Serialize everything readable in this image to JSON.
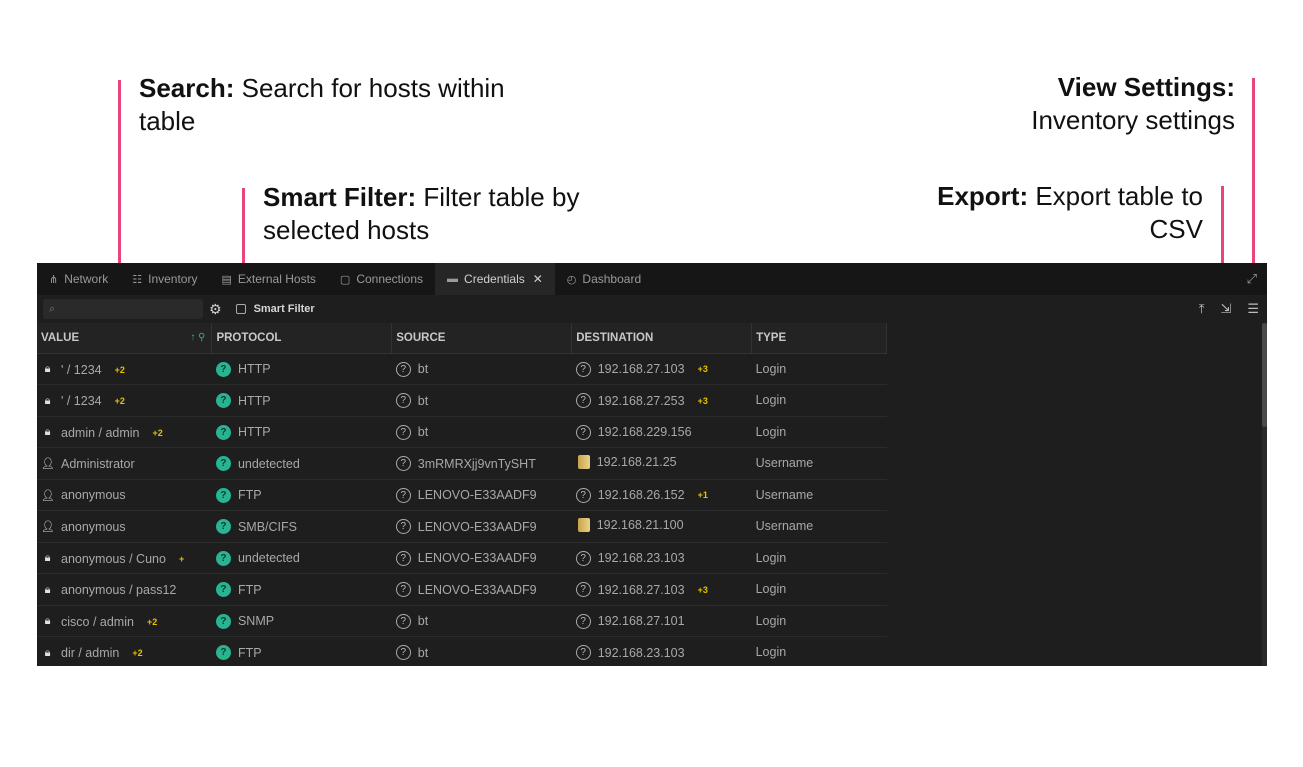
{
  "annotations": {
    "search": {
      "title": "Search:",
      "text": "Search for hosts within table"
    },
    "smart_filter": {
      "title": "Smart Filter:",
      "text": "Filter table by selected hosts"
    },
    "view_settings": {
      "title": "View Settings:",
      "text": "Inventory settings"
    },
    "export": {
      "title": "Export:",
      "text": "Export table to CSV"
    }
  },
  "colors": {
    "accent_line": "#e8457a",
    "protocol_icon": "#27b48f",
    "badge": "#e6c200"
  },
  "tabs": [
    {
      "label": "Network",
      "icon": "network-icon"
    },
    {
      "label": "Inventory",
      "icon": "inventory-icon"
    },
    {
      "label": "External Hosts",
      "icon": "external-hosts-icon"
    },
    {
      "label": "Connections",
      "icon": "connections-icon"
    },
    {
      "label": "Credentials",
      "icon": "credentials-icon",
      "active": true
    },
    {
      "label": "Dashboard",
      "icon": "dashboard-icon"
    }
  ],
  "toolbar": {
    "search_placeholder": "",
    "smart_filter_label": "Smart Filter"
  },
  "table": {
    "columns": [
      "VALUE",
      "PROTOCOL",
      "SOURCE",
      "DESTINATION",
      "TYPE"
    ],
    "rows": [
      {
        "icon": "lock",
        "value": "' / 1234",
        "value_badge": "+2",
        "protocol": "HTTP",
        "source": "bt",
        "dest_icon": "question",
        "destination": "192.168.27.103",
        "dest_badge": "+3",
        "type": "Login"
      },
      {
        "icon": "lock",
        "value": "' / 1234",
        "value_badge": "+2",
        "protocol": "HTTP",
        "source": "bt",
        "dest_icon": "question",
        "destination": "192.168.27.253",
        "dest_badge": "+3",
        "type": "Login"
      },
      {
        "icon": "lock",
        "value": "admin / admin",
        "value_badge": "+2",
        "protocol": "HTTP",
        "source": "bt",
        "dest_icon": "question",
        "destination": "192.168.229.156",
        "dest_badge": "",
        "type": "Login"
      },
      {
        "icon": "user",
        "value": "Administrator",
        "value_badge": "",
        "protocol": "undetected",
        "source": "3mRMRXjj9vnTySHT",
        "dest_icon": "device",
        "destination": "192.168.21.25",
        "dest_badge": "",
        "type": "Username"
      },
      {
        "icon": "user",
        "value": "anonymous",
        "value_badge": "",
        "protocol": "FTP",
        "source": "LENOVO-E33AADF9",
        "dest_icon": "question",
        "destination": "192.168.26.152",
        "dest_badge": "+1",
        "type": "Username"
      },
      {
        "icon": "user",
        "value": "anonymous",
        "value_badge": "",
        "protocol": "SMB/CIFS",
        "source": "LENOVO-E33AADF9",
        "dest_icon": "device",
        "destination": "192.168.21.100",
        "dest_badge": "",
        "type": "Username"
      },
      {
        "icon": "lock",
        "value": "anonymous / Cuno",
        "value_badge": "+",
        "protocol": "undetected",
        "source": "LENOVO-E33AADF9",
        "dest_icon": "question",
        "destination": "192.168.23.103",
        "dest_badge": "",
        "type": "Login"
      },
      {
        "icon": "lock",
        "value": "anonymous / pass12",
        "value_badge": "",
        "protocol": "FTP",
        "source": "LENOVO-E33AADF9",
        "dest_icon": "question",
        "destination": "192.168.27.103",
        "dest_badge": "+3",
        "type": "Login"
      },
      {
        "icon": "lock",
        "value": "cisco / admin",
        "value_badge": "+2",
        "protocol": "SNMP",
        "source": "bt",
        "dest_icon": "question",
        "destination": "192.168.27.101",
        "dest_badge": "",
        "type": "Login"
      },
      {
        "icon": "lock",
        "value": "dir / admin",
        "value_badge": "+2",
        "protocol": "FTP",
        "source": "bt",
        "dest_icon": "question",
        "destination": "192.168.23.103",
        "dest_badge": "",
        "type": "Login"
      }
    ]
  }
}
